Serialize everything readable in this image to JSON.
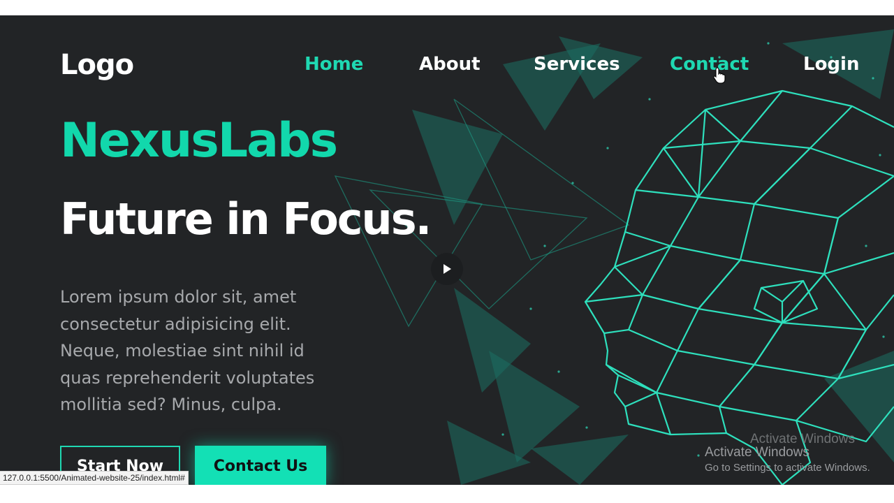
{
  "nav": {
    "logo": "Logo",
    "links": [
      "Home",
      "About",
      "Services",
      "Contact",
      "Login"
    ]
  },
  "hero": {
    "brand": "NexusLabs",
    "headline": "Future in Focus.",
    "description_lines": [
      "Lorem ipsum dolor sit, amet",
      "consectetur adipisicing elit.",
      "Neque, molestiae sint nihil id",
      "quas reprehenderit voluptates",
      "mollitia sed? Minus, culpa."
    ],
    "start_button": "Start Now",
    "contact_button": "Contact Us",
    "play_icon": "play-icon"
  },
  "watermark": {
    "title": "Activate Windows",
    "subtitle": "Go to Settings to activate Windows."
  },
  "status_url": "127.0.0.1:5500/Animated-website-25/index.html#",
  "colors": {
    "accent": "#13e0b5",
    "background": "#222426",
    "text": "#ffffff",
    "muted_text": "#a7a9ac"
  }
}
